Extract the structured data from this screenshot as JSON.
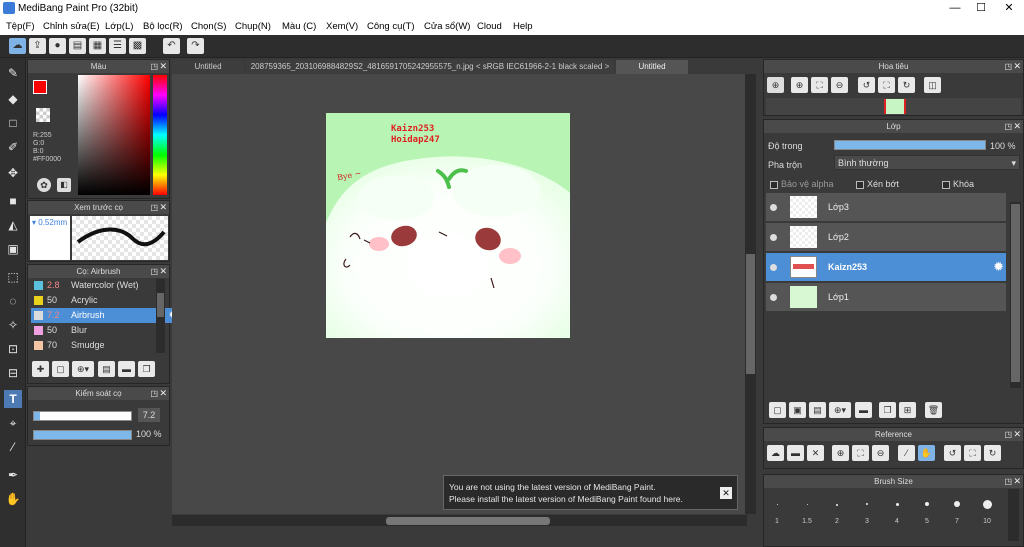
{
  "window": {
    "title": "MediBang Paint Pro (32bit)",
    "minimize": "—",
    "maximize": "☐",
    "close": "✕"
  },
  "menu": [
    "Tệp(F)",
    "Chỉnh sửa(E)",
    "Lớp(L)",
    "Bộ lọc(R)",
    "Chọn(S)",
    "Chụp(N)",
    "Màu (C)",
    "Xem(V)",
    "Công cụ(T)",
    "Cửa sổ(W)",
    "Cloud",
    "Help"
  ],
  "color_panel": {
    "title": "Màu",
    "r": "R:255",
    "g": "G:0",
    "b": "B:0",
    "hex": "#FF0000",
    "primary": "#ff0000"
  },
  "brush_preview": {
    "title": "Xem trước cọ",
    "size": "0.52mm"
  },
  "brush_panel": {
    "title": "Cọ: Airbrush",
    "items": [
      {
        "size": "2.8",
        "name": "Watercolor (Wet)",
        "color": "#5bc0de"
      },
      {
        "size": "50",
        "name": "Acrylic",
        "color": "#e8d21c"
      },
      {
        "size": "7.2",
        "name": "Airbrush",
        "color": "#dcdcdc",
        "selected": true
      },
      {
        "size": "50",
        "name": "Blur",
        "color": "#f0a0e0"
      },
      {
        "size": "70",
        "name": "Smudge",
        "color": "#f5c6a5"
      }
    ]
  },
  "brush_control": {
    "title": "Kiểm soát cọ",
    "size_value": "7.2",
    "opacity_value": "100 %",
    "size_fraction": 0.06,
    "opacity_fraction": 1.0
  },
  "tabs": [
    "Untitled",
    "208759365_2031069884829S2_4816591705242955575_n.jpg < sRGB IEC61966-2-1 black scaled >",
    "Untitled"
  ],
  "artwork": {
    "text1": "Kaizn253",
    "text2": "Hoidap247",
    "bye": "Bye ~"
  },
  "notice": {
    "line1": "You are not using the latest version of MediBang Paint.",
    "line2": "Please install the latest version of MediBang Paint found here."
  },
  "navigator": {
    "title": "Hoa tiêu"
  },
  "layer_panel": {
    "title": "Lớp",
    "opacity_label": "Độ trong",
    "opacity_value": "100 %",
    "opacity_fraction": 1.0,
    "blend_label": "Pha trộn",
    "blend_value": "Bình thường",
    "alpha_label": "Bảo vệ alpha",
    "clip_label": "Xén bớt",
    "lock_label": "Khóa",
    "layers": [
      {
        "name": "Lớp3"
      },
      {
        "name": "Lớp2"
      },
      {
        "name": "Kaizn253",
        "selected": true
      },
      {
        "name": "Lớp1"
      }
    ]
  },
  "reference": {
    "title": "Reference"
  },
  "brush_size": {
    "title": "Brush Size",
    "sizes": [
      "1",
      "1.5",
      "2",
      "3",
      "4",
      "5",
      "7",
      "10"
    ]
  }
}
